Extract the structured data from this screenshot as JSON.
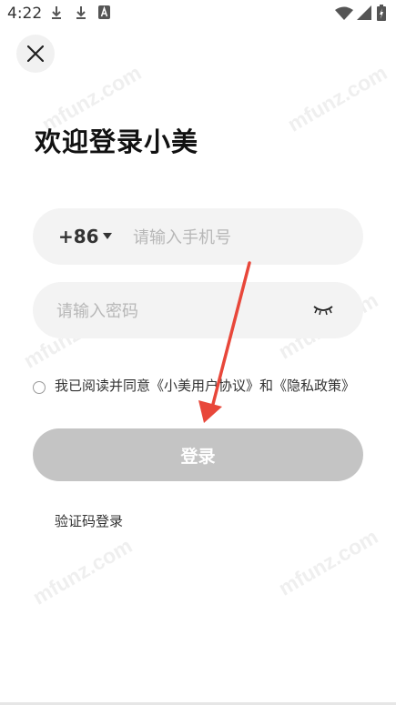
{
  "status_bar": {
    "time": "4:22",
    "left_icons": [
      "download-icon",
      "download-icon",
      "app-icon"
    ],
    "right_icons": [
      "wifi-icon",
      "signal-icon",
      "battery-charging-icon"
    ]
  },
  "header": {
    "close_icon": "close-icon"
  },
  "page": {
    "title": "欢迎登录小美"
  },
  "phone_field": {
    "country_code": "+86",
    "placeholder": "请输入手机号"
  },
  "password_field": {
    "placeholder": "请输入密码",
    "visibility_icon": "eye-closed-icon"
  },
  "agreement": {
    "text": "我已阅读并同意《小美用户协议》和《隐私政策》",
    "checked": false
  },
  "login_button": {
    "label": "登录"
  },
  "alt_login": {
    "label": "验证码登录"
  },
  "watermark": {
    "text": "mfunz.com"
  },
  "colors": {
    "button_disabled": "#c4c4c4",
    "field_bg": "#f3f3f3",
    "annotation_arrow": "#e8473a"
  }
}
